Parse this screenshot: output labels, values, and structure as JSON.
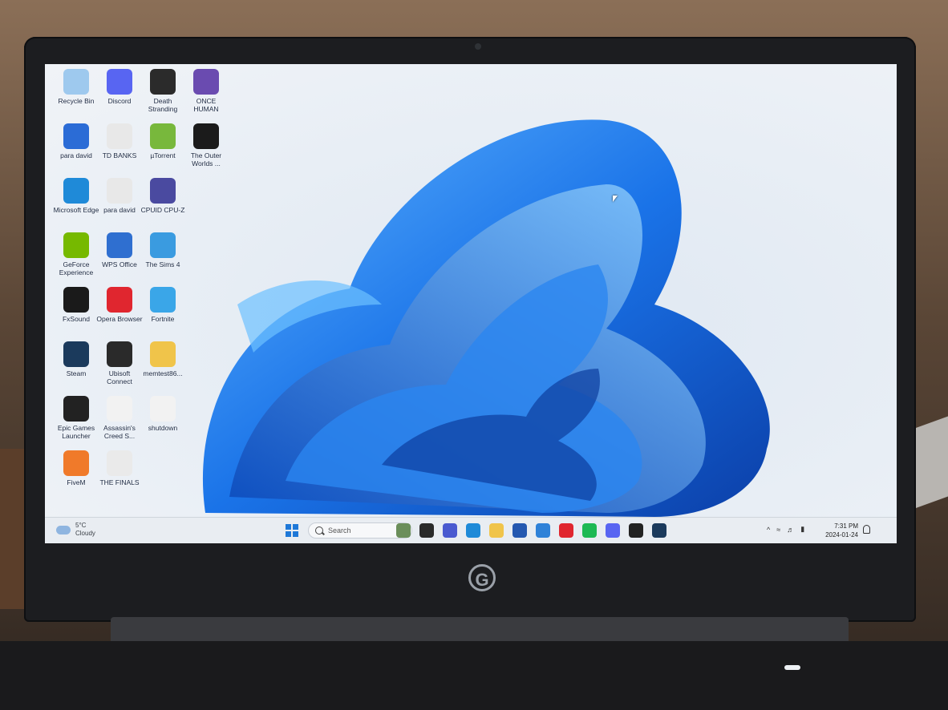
{
  "desktop": {
    "icons": [
      {
        "label": "Recycle Bin",
        "icon": "recycle-bin-icon",
        "color": "#9ec9ee"
      },
      {
        "label": "Discord",
        "icon": "discord-icon",
        "color": "#5865f2"
      },
      {
        "label": "Death Stranding",
        "icon": "death-stranding-icon",
        "color": "#2b2b2b"
      },
      {
        "label": "ONCE HUMAN",
        "icon": "once-human-icon",
        "color": "#6a4bb0"
      },
      {
        "label": "para david",
        "icon": "word-document-icon",
        "color": "#2b6cd6"
      },
      {
        "label": "TD BANKS",
        "icon": "document-icon",
        "color": "#e8e8e8"
      },
      {
        "label": "µTorrent",
        "icon": "utorrent-icon",
        "color": "#78b83c"
      },
      {
        "label": "The Outer Worlds ...",
        "icon": "outer-worlds-icon",
        "color": "#1b1b1b"
      },
      {
        "label": "Microsoft Edge",
        "icon": "edge-icon",
        "color": "#1f8ad8"
      },
      {
        "label": "para david",
        "icon": "document-icon",
        "color": "#e8e8e8"
      },
      {
        "label": "CPUID CPU-Z",
        "icon": "cpu-z-icon",
        "color": "#4a4aa0"
      },
      {
        "label": "GeForce Experience",
        "icon": "geforce-icon",
        "color": "#76b900"
      },
      {
        "label": "WPS Office",
        "icon": "wps-office-icon",
        "color": "#2f6fd0"
      },
      {
        "label": "The Sims 4",
        "icon": "sims-icon",
        "color": "#3a9be0"
      },
      {
        "label": "FxSound",
        "icon": "fxsound-icon",
        "color": "#1a1a1a"
      },
      {
        "label": "Opera Browser",
        "icon": "opera-icon",
        "color": "#e0262f"
      },
      {
        "label": "Fortnite",
        "icon": "fortnite-icon",
        "color": "#3aa6e8"
      },
      {
        "label": "Steam",
        "icon": "steam-icon",
        "color": "#1b3a5c"
      },
      {
        "label": "Ubisoft Connect",
        "icon": "ubisoft-icon",
        "color": "#2a2a2a"
      },
      {
        "label": "memtest86...",
        "icon": "folder-icon",
        "color": "#f0c44a"
      },
      {
        "label": "Epic Games Launcher",
        "icon": "epic-games-icon",
        "color": "#222222"
      },
      {
        "label": "Assassin's Creed S...",
        "icon": "assassins-creed-icon",
        "color": "#f2f2f2"
      },
      {
        "label": "shutdown",
        "icon": "shutdown-icon",
        "color": "#f2f2f2"
      },
      {
        "label": "FiveM",
        "icon": "fivem-icon",
        "color": "#f07a2a"
      },
      {
        "label": "THE FINALS",
        "icon": "the-finals-icon",
        "color": "#eaeaea"
      }
    ]
  },
  "taskbar": {
    "weather_temp": "5°C",
    "weather_desc": "Cloudy",
    "search_placeholder": "Search",
    "pinned": [
      {
        "name": "copilot-icon",
        "color": "#6b8e5a"
      },
      {
        "name": "task-view-icon",
        "color": "#2a2a2a"
      },
      {
        "name": "chat-icon",
        "color": "#4a5ad0"
      },
      {
        "name": "edge-icon",
        "color": "#1f8ad8"
      },
      {
        "name": "file-explorer-icon",
        "color": "#f0c44a"
      },
      {
        "name": "store-icon",
        "color": "#2458b0"
      },
      {
        "name": "mail-icon",
        "color": "#2f82d8"
      },
      {
        "name": "opera-icon",
        "color": "#e0262f"
      },
      {
        "name": "spotify-icon",
        "color": "#1db954"
      },
      {
        "name": "discord-icon",
        "color": "#5865f2"
      },
      {
        "name": "epic-games-icon",
        "color": "#222222"
      },
      {
        "name": "steam-icon",
        "color": "#1b3a5c"
      }
    ],
    "time": "7:31 PM",
    "date": "2024-01-24"
  }
}
